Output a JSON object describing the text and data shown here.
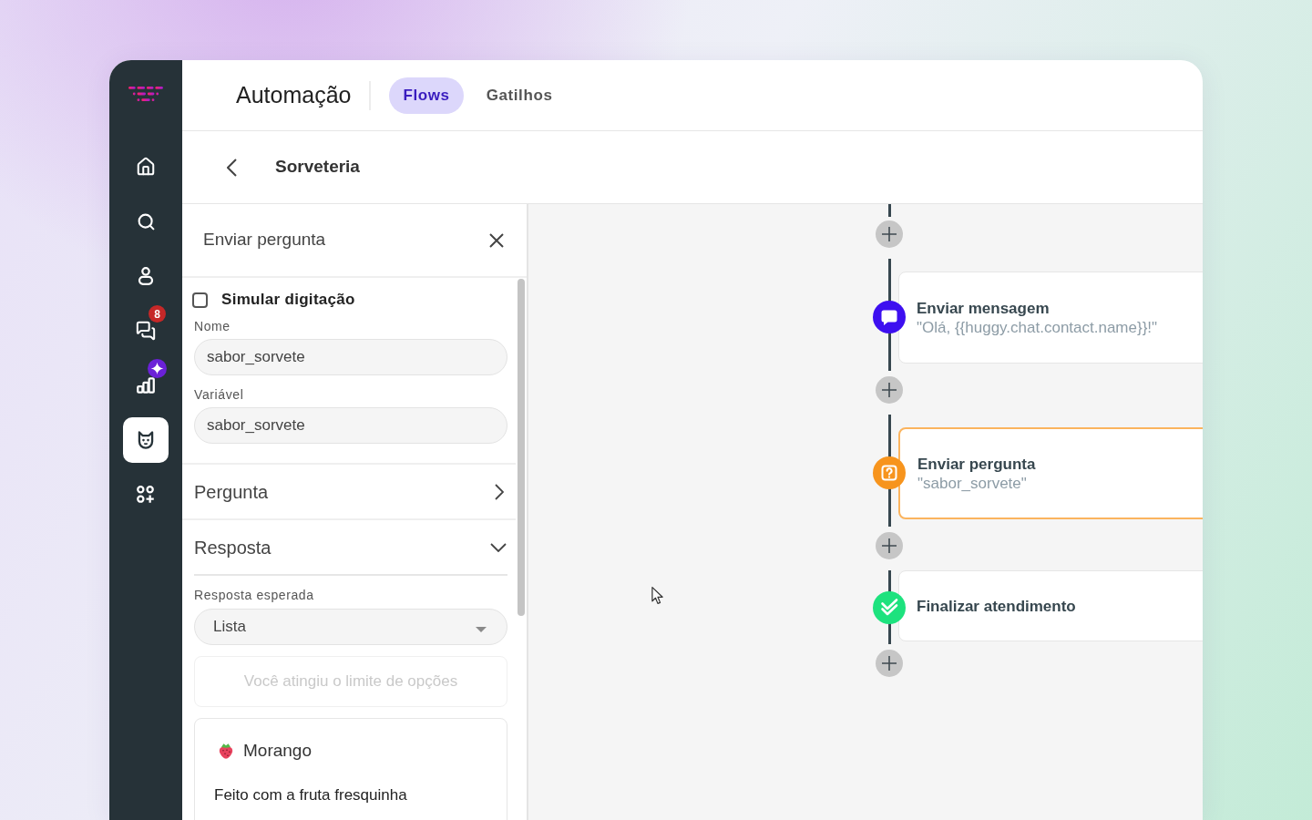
{
  "sidebar": {
    "items": [
      {
        "selected": false
      },
      {
        "selected": false
      },
      {
        "selected": false
      },
      {
        "selected": false,
        "badge": {
          "kind": "count",
          "text": "8"
        }
      },
      {
        "selected": false,
        "badge": {
          "kind": "sparkle"
        }
      },
      {
        "selected": true
      },
      {
        "selected": false
      }
    ]
  },
  "header": {
    "title": "Automação",
    "tabs": [
      {
        "label": "Flows",
        "selected": true
      },
      {
        "label": "Gatilhos",
        "selected": false
      }
    ]
  },
  "subheader": {
    "title": "Sorveteria"
  },
  "panel": {
    "title": "Enviar pergunta",
    "simulate_typing": {
      "label": "Simular digitação",
      "checked": false
    },
    "fields": [
      {
        "label": "Nome",
        "value": "sabor_sorvete"
      },
      {
        "label": "Variável",
        "value": "sabor_sorvete"
      }
    ],
    "sections": [
      {
        "title": "Pergunta",
        "expanded": false
      },
      {
        "title": "Resposta",
        "expanded": true,
        "expected_answer": {
          "label": "Resposta esperada",
          "value": "Lista"
        },
        "notice": "Você atingiu o limite de opções",
        "options": [
          {
            "title": "Morango",
            "description": "Feito com a fruta fresquinha"
          }
        ]
      }
    ]
  },
  "flow": {
    "nodes": [
      {
        "kind": "message",
        "title": "Enviar mensagem",
        "detail": "\"Olá, {{huggy.chat.contact.name}}!\"",
        "selected": false
      },
      {
        "kind": "question",
        "title": "Enviar pergunta",
        "detail": "\"sabor_sorvete\"",
        "selected": true
      },
      {
        "kind": "end",
        "title": "Finalizar atendimento",
        "selected": false
      }
    ]
  }
}
